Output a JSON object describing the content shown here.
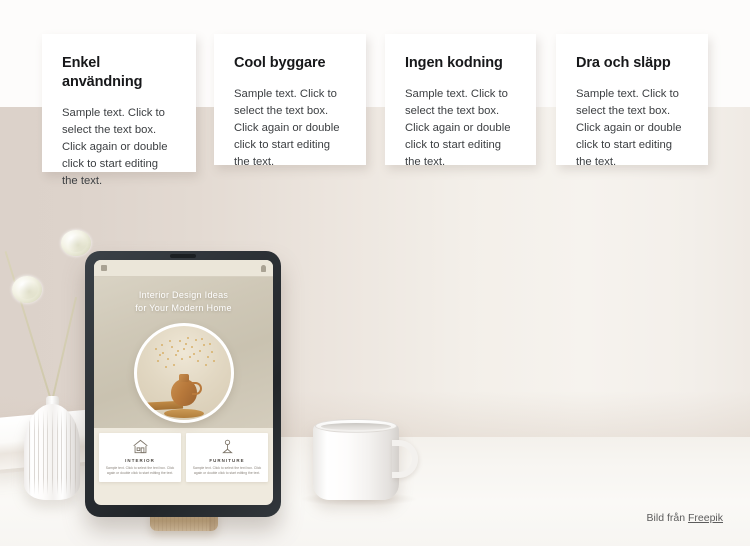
{
  "feature_cards": [
    {
      "title": "Enkel användning",
      "body": "Sample text. Click to select the text box. Click again or double click to start editing the text."
    },
    {
      "title": "Cool byggare",
      "body": "Sample text. Click to select the text box. Click again or double click to start editing the text."
    },
    {
      "title": "Ingen kodning",
      "body": "Sample text. Click to select the text box. Click again or double click to start editing the text."
    },
    {
      "title": "Dra och släpp",
      "body": "Sample text. Click to select the text box. Click again or double click to start editing the text."
    }
  ],
  "tablet": {
    "topbar": {
      "menu_icon": "hamburger-menu-icon",
      "notification_icon": "bell-icon"
    },
    "hero": {
      "title_line1": "Interior Design Ideas",
      "title_line2": "for Your Modern Home",
      "photo": "terracotta-vase-photo"
    },
    "mini_cards": [
      {
        "icon": "house-interior-icon",
        "label": "INTERIOR",
        "body": "Sample text. Click to select the text box. Click again or double click to start editing the text."
      },
      {
        "icon": "lamp-furniture-icon",
        "label": "FURNITURE",
        "body": "Sample text. Click to select the text box. Click again or double click to start editing the text."
      }
    ]
  },
  "scene": {
    "vase": "white-ribbed-vase",
    "flowers": "dried-allium-flowers",
    "mug": "white-coffee-mug",
    "stand": "wooden-tablet-stand"
  },
  "attribution": {
    "prefix": "Bild från ",
    "link_label": "Freepik"
  },
  "colors": {
    "wall_left": "#dcd2ca",
    "wall_right": "#f5f2ed",
    "band_top": "#fdfcfb",
    "desk": "#faf9f6",
    "card_bg": "#ffffff",
    "heading": "#17181a",
    "body_text": "#3c3f42",
    "screen_bg": "#efeade",
    "screen_hero": "#cfc8b7",
    "tablet_frame": "#2c3136",
    "stand_wood": "#c5a779"
  }
}
